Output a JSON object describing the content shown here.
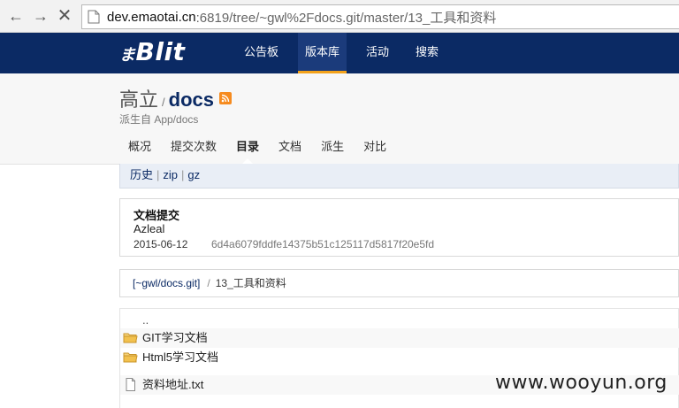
{
  "browser": {
    "url_domain": "dev.emaotai.cn",
    "url_rest": ":6819/tree/~gwl%2Fdocs.git/master/13_工具和资料"
  },
  "site": {
    "logo": "Blit",
    "logo_prefix": "ま",
    "nav": [
      {
        "label": "公告板"
      },
      {
        "label": "版本库"
      },
      {
        "label": "活动"
      },
      {
        "label": "搜索"
      }
    ]
  },
  "repo": {
    "owner": "高立",
    "separator": "/",
    "name": "docs",
    "fork_of": "派生自 App/docs",
    "tabs": [
      {
        "label": "概况"
      },
      {
        "label": "提交次数"
      },
      {
        "label": "目录"
      },
      {
        "label": "文档"
      },
      {
        "label": "派生"
      },
      {
        "label": "对比"
      }
    ]
  },
  "subbar": {
    "history": "历史",
    "zip": "zip",
    "gz": "gz",
    "pipe": "|"
  },
  "commit": {
    "title": "文档提交",
    "author": "Azleal",
    "date": "2015-06-12",
    "hash": "6d4a6079fddfe14375b51c125117d5817f20e5fd"
  },
  "breadcrumb": {
    "root": "[~gwl/docs.git]",
    "slash": "/",
    "current": "13_工具和资料"
  },
  "files": [
    {
      "name": "..",
      "type": "up"
    },
    {
      "name": "GIT学习文档",
      "type": "folder"
    },
    {
      "name": "Html5学习文档",
      "type": "folder"
    },
    {
      "name": "资料地址.txt",
      "type": "file"
    }
  ],
  "watermark": "www.wooyun.org",
  "colors": {
    "header_bg": "#0b2a64",
    "nav_active_underline": "#f3a21b",
    "folder": "#f2c14e"
  }
}
